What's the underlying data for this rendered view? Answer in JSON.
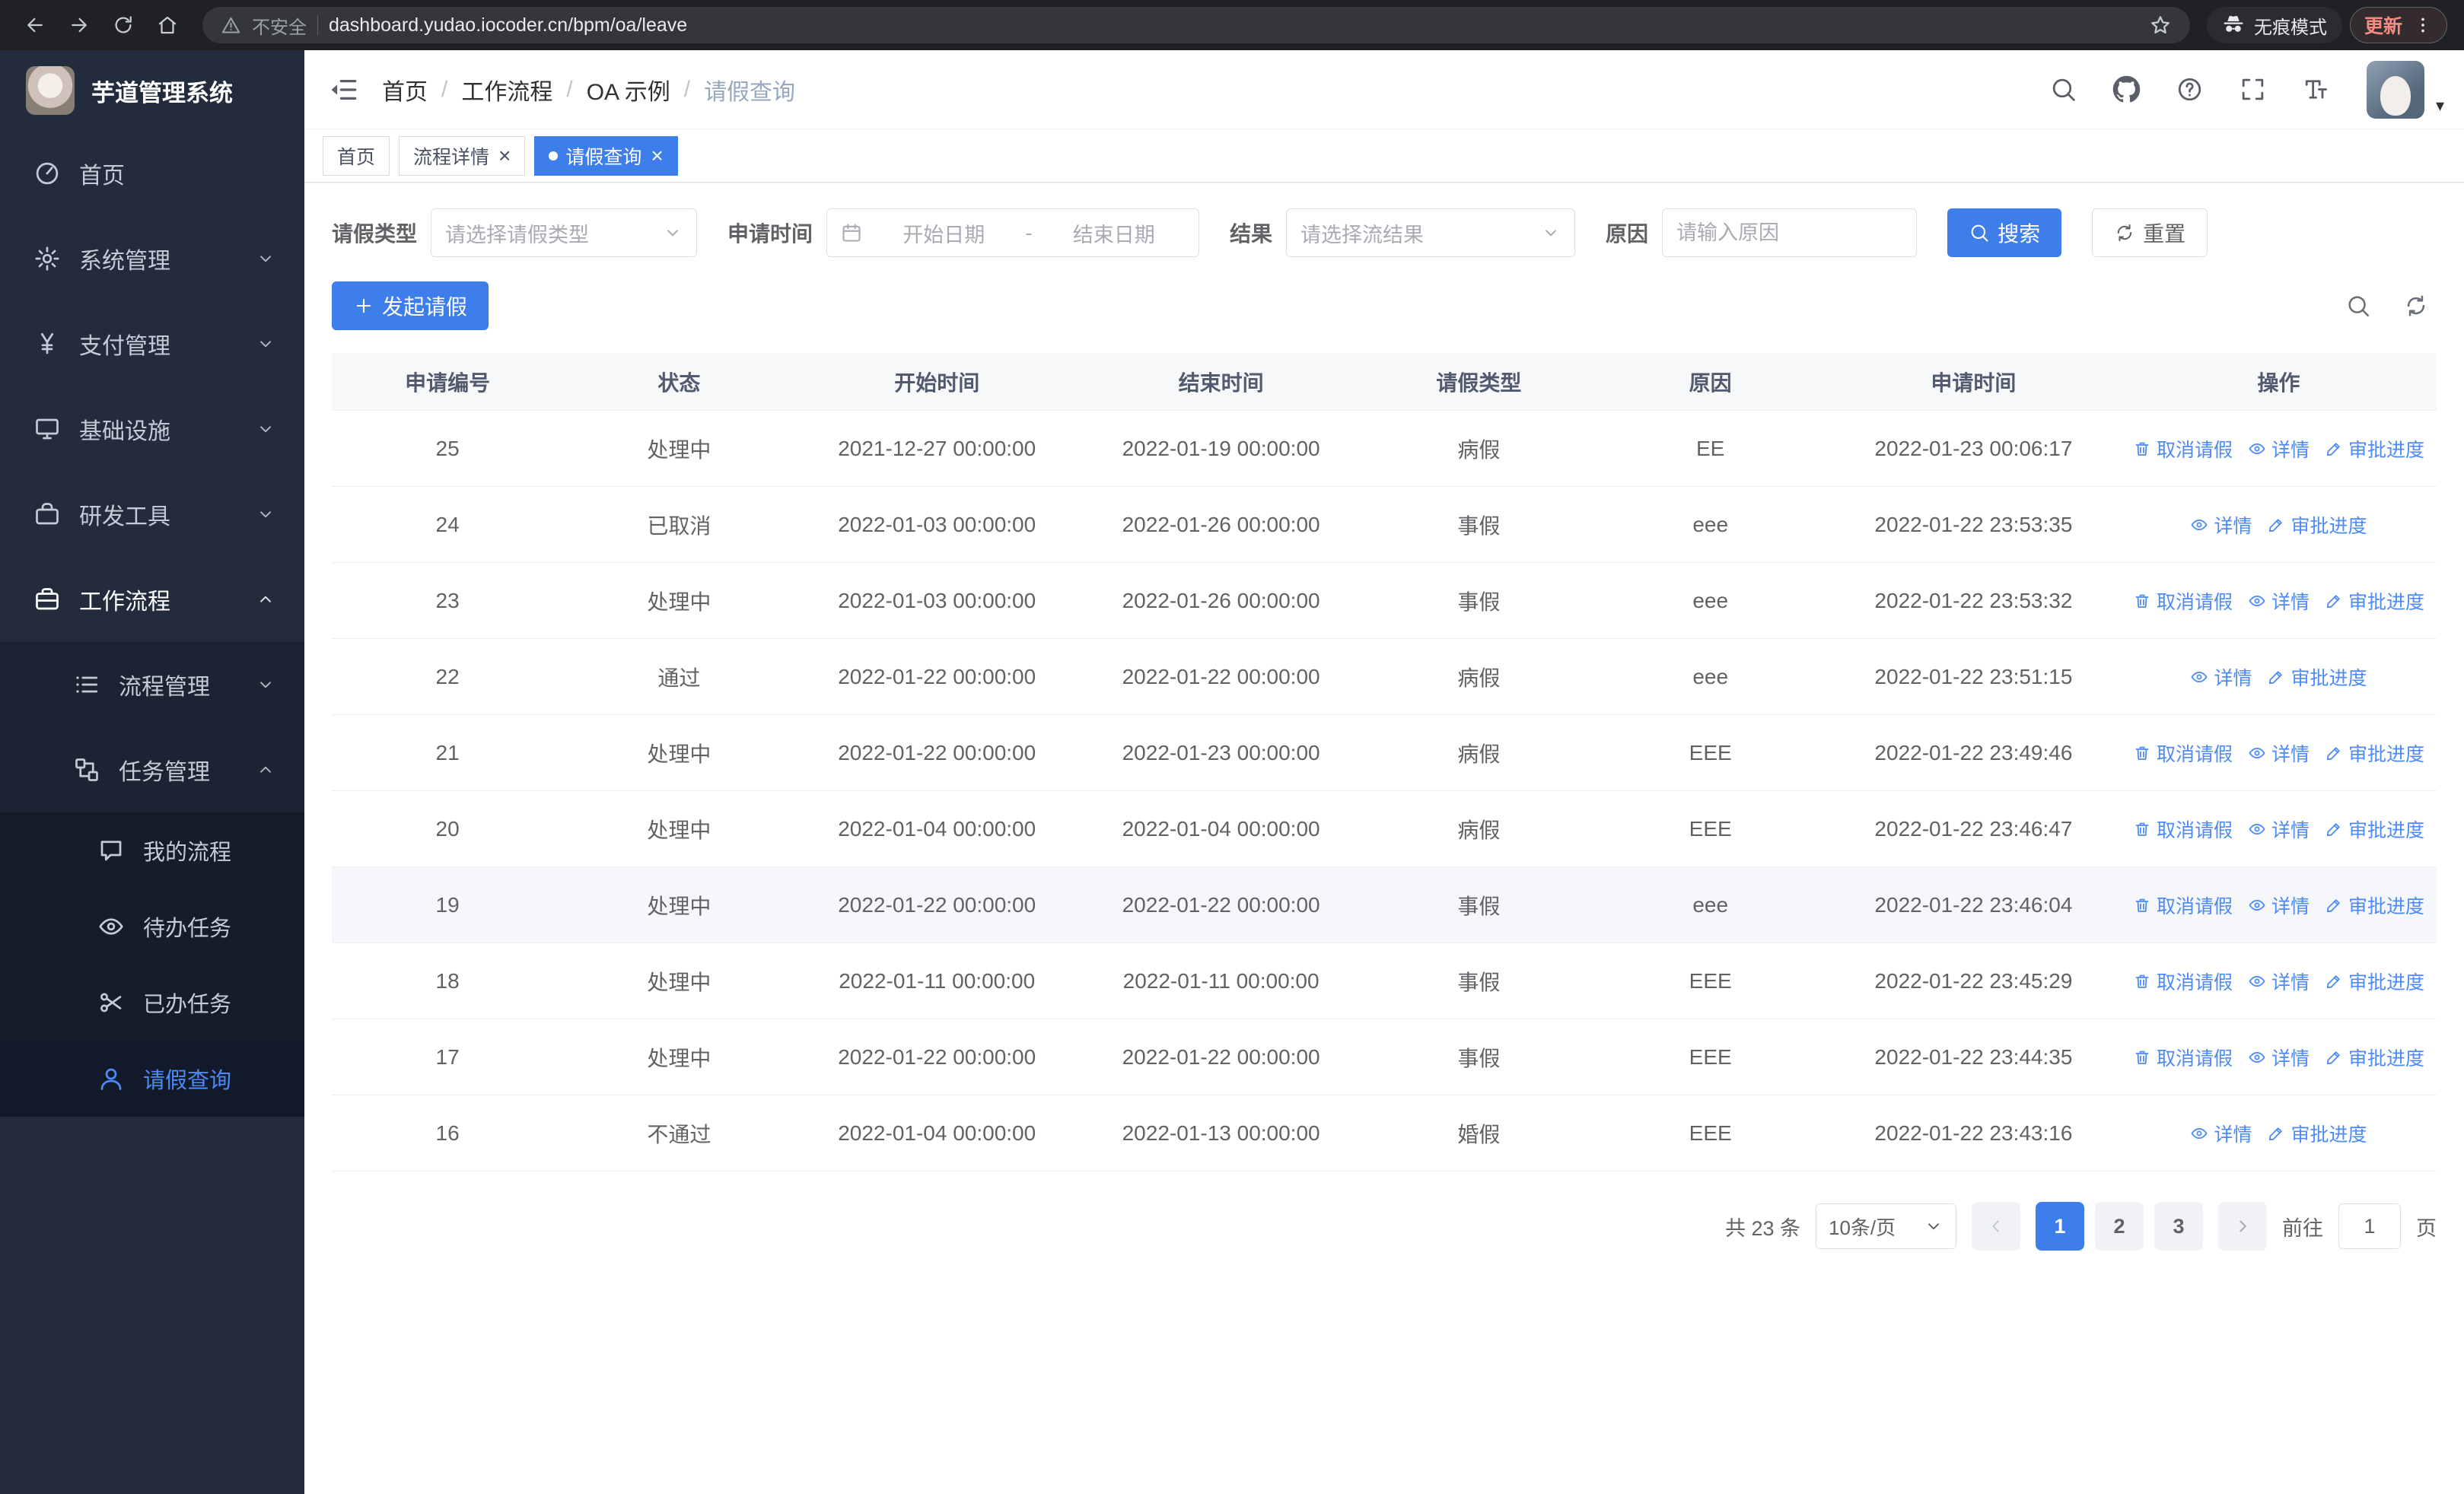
{
  "colors": {
    "accent": "#3D7EEA",
    "link": "#4C8BF5",
    "sidebar_bg": "#222C3C",
    "sidebar_sub_bg": "#1B2433",
    "sidebar_subsub_bg": "#151D2A",
    "sidebar_active_bg": "#11192A",
    "sidebar_text": "#C3CBD6"
  },
  "browser": {
    "security_warning": "不安全",
    "url": "dashboard.yudao.iocoder.cn/bpm/oa/leave",
    "incognito_label": "无痕模式",
    "update_label": "更新"
  },
  "app": {
    "title": "芋道管理系统"
  },
  "sidebar": {
    "items": [
      {
        "key": "home",
        "label": "首页",
        "icon": "dashboard-icon"
      },
      {
        "key": "system",
        "label": "系统管理",
        "icon": "gear-icon",
        "chevron": "down"
      },
      {
        "key": "payment",
        "label": "支付管理",
        "icon": "yen-icon",
        "chevron": "down"
      },
      {
        "key": "infra",
        "label": "基础设施",
        "icon": "infra-icon",
        "chevron": "down"
      },
      {
        "key": "devtools",
        "label": "研发工具",
        "icon": "tools-icon",
        "chevron": "down"
      },
      {
        "key": "workflow",
        "label": "工作流程",
        "icon": "workflow-icon",
        "chevron": "up",
        "open": true,
        "children": [
          {
            "key": "process-mgmt",
            "label": "流程管理",
            "icon": "process-icon",
            "chevron": "down"
          },
          {
            "key": "task-mgmt",
            "label": "任务管理",
            "icon": "task-icon",
            "chevron": "up",
            "open": true,
            "children": [
              {
                "key": "my-process",
                "label": "我的流程",
                "icon": "chat-icon"
              },
              {
                "key": "todo-tasks",
                "label": "待办任务",
                "icon": "eye-icon"
              },
              {
                "key": "done-tasks",
                "label": "已办任务",
                "icon": "scissors-icon"
              },
              {
                "key": "leave-query",
                "label": "请假查询",
                "icon": "user-icon",
                "active": true
              }
            ]
          }
        ]
      }
    ]
  },
  "header": {
    "breadcrumb": [
      "首页",
      "工作流程",
      "OA 示例",
      "请假查询"
    ],
    "icons": [
      "search-icon",
      "github-icon",
      "help-icon",
      "fullscreen-icon",
      "font-size-icon"
    ]
  },
  "tabs": [
    {
      "key": "home",
      "label": "首页",
      "closable": false,
      "active": false
    },
    {
      "key": "process-detail",
      "label": "流程详情",
      "closable": true,
      "active": false
    },
    {
      "key": "leave-query",
      "label": "请假查询",
      "closable": true,
      "active": true
    }
  ],
  "filters": {
    "type": {
      "label": "请假类型",
      "placeholder": "请选择请假类型"
    },
    "time": {
      "label": "申请时间",
      "start_placeholder": "开始日期",
      "separator": "-",
      "end_placeholder": "结束日期"
    },
    "result": {
      "label": "结果",
      "placeholder": "请选择流结果"
    },
    "reason": {
      "label": "原因",
      "placeholder": "请输入原因"
    },
    "search_label": "搜索",
    "reset_label": "重置"
  },
  "toolbar": {
    "create_label": "发起请假"
  },
  "table": {
    "columns": [
      "申请编号",
      "状态",
      "开始时间",
      "结束时间",
      "请假类型",
      "原因",
      "申请时间",
      "操作"
    ],
    "action_defs": {
      "cancel": {
        "label": "取消请假",
        "icon": "trash-icon",
        "name": "cancel-leave-link"
      },
      "detail": {
        "label": "详情",
        "icon": "eye-icon",
        "name": "detail-link"
      },
      "progress": {
        "label": "审批进度",
        "icon": "edit-icon",
        "name": "approval-progress-link"
      }
    },
    "rows": [
      {
        "id": "25",
        "status": "处理中",
        "start_time": "2021-12-27 00:00:00",
        "end_time": "2022-01-19 00:00:00",
        "leave_type": "病假",
        "reason": "EE",
        "apply_time": "2022-01-23 00:06:17",
        "actions": [
          "cancel",
          "detail",
          "progress"
        ]
      },
      {
        "id": "24",
        "status": "已取消",
        "start_time": "2022-01-03 00:00:00",
        "end_time": "2022-01-26 00:00:00",
        "leave_type": "事假",
        "reason": "eee",
        "apply_time": "2022-01-22 23:53:35",
        "actions": [
          "detail",
          "progress"
        ]
      },
      {
        "id": "23",
        "status": "处理中",
        "start_time": "2022-01-03 00:00:00",
        "end_time": "2022-01-26 00:00:00",
        "leave_type": "事假",
        "reason": "eee",
        "apply_time": "2022-01-22 23:53:32",
        "actions": [
          "cancel",
          "detail",
          "progress"
        ]
      },
      {
        "id": "22",
        "status": "通过",
        "start_time": "2022-01-22 00:00:00",
        "end_time": "2022-01-22 00:00:00",
        "leave_type": "病假",
        "reason": "eee",
        "apply_time": "2022-01-22 23:51:15",
        "actions": [
          "detail",
          "progress"
        ]
      },
      {
        "id": "21",
        "status": "处理中",
        "start_time": "2022-01-22 00:00:00",
        "end_time": "2022-01-23 00:00:00",
        "leave_type": "病假",
        "reason": "EEE",
        "apply_time": "2022-01-22 23:49:46",
        "actions": [
          "cancel",
          "detail",
          "progress"
        ]
      },
      {
        "id": "20",
        "status": "处理中",
        "start_time": "2022-01-04 00:00:00",
        "end_time": "2022-01-04 00:00:00",
        "leave_type": "病假",
        "reason": "EEE",
        "apply_time": "2022-01-22 23:46:47",
        "actions": [
          "cancel",
          "detail",
          "progress"
        ]
      },
      {
        "id": "19",
        "status": "处理中",
        "start_time": "2022-01-22 00:00:00",
        "end_time": "2022-01-22 00:00:00",
        "leave_type": "事假",
        "reason": "eee",
        "apply_time": "2022-01-22 23:46:04",
        "actions": [
          "cancel",
          "detail",
          "progress"
        ],
        "highlighted": true
      },
      {
        "id": "18",
        "status": "处理中",
        "start_time": "2022-01-11 00:00:00",
        "end_time": "2022-01-11 00:00:00",
        "leave_type": "事假",
        "reason": "EEE",
        "apply_time": "2022-01-22 23:45:29",
        "actions": [
          "cancel",
          "detail",
          "progress"
        ]
      },
      {
        "id": "17",
        "status": "处理中",
        "start_time": "2022-01-22 00:00:00",
        "end_time": "2022-01-22 00:00:00",
        "leave_type": "事假",
        "reason": "EEE",
        "apply_time": "2022-01-22 23:44:35",
        "actions": [
          "cancel",
          "detail",
          "progress"
        ]
      },
      {
        "id": "16",
        "status": "不通过",
        "start_time": "2022-01-04 00:00:00",
        "end_time": "2022-01-13 00:00:00",
        "leave_type": "婚假",
        "reason": "EEE",
        "apply_time": "2022-01-22 23:43:16",
        "actions": [
          "detail",
          "progress"
        ]
      }
    ]
  },
  "pagination": {
    "total_label": "共 23 条",
    "page_size": "10条/页",
    "pages": [
      1,
      2,
      3
    ],
    "active_page": 1,
    "goto_prefix": "前往",
    "goto_value": "1",
    "goto_suffix": "页"
  }
}
